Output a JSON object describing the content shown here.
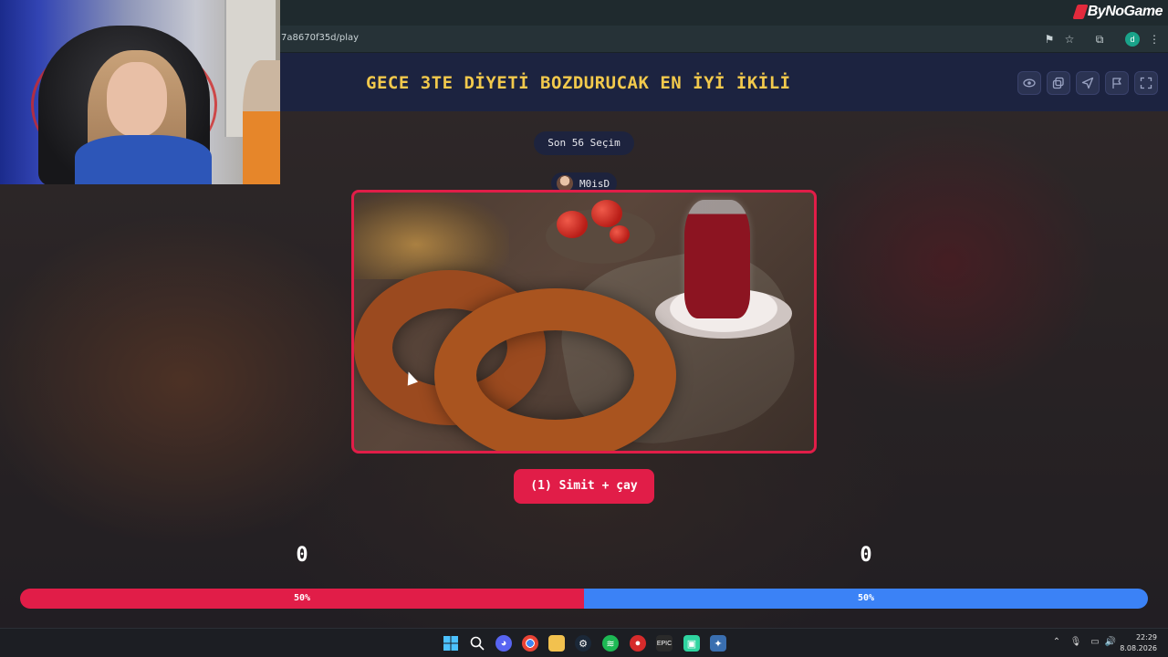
{
  "browser": {
    "url": "7a8670f35d/play",
    "brand": "ByNoGame"
  },
  "game": {
    "title": "GECE 3TE DİYETİ BOZDURUCAK EN İYİ İKİLİ",
    "round_label": "Son 56 Seçim",
    "user_name": "M0isD",
    "choice_label": "(1) Simit + çay",
    "left_score": "0",
    "right_score": "0",
    "left_percent_label": "50%",
    "right_percent_label": "50%",
    "left_fraction": 0.5,
    "right_fraction": 0.5
  },
  "header_icons": [
    "eye-icon",
    "copy-icon",
    "send-icon",
    "flag-icon",
    "fullscreen-icon"
  ],
  "taskbar": {
    "time": "22:29",
    "date": "8.08.2026",
    "apps": [
      "windows-start-icon",
      "search-icon",
      "discord-icon",
      "chrome-icon",
      "file-explorer-icon",
      "steam-icon",
      "spotify-icon",
      "app-icon",
      "epic-games-icon",
      "chat-app-icon",
      "settings-app-icon"
    ]
  },
  "colors": {
    "accent_red": "#e11d48",
    "accent_blue": "#3b82f6",
    "title_yellow": "#f2c94c",
    "header_bg": "#1c2340"
  }
}
